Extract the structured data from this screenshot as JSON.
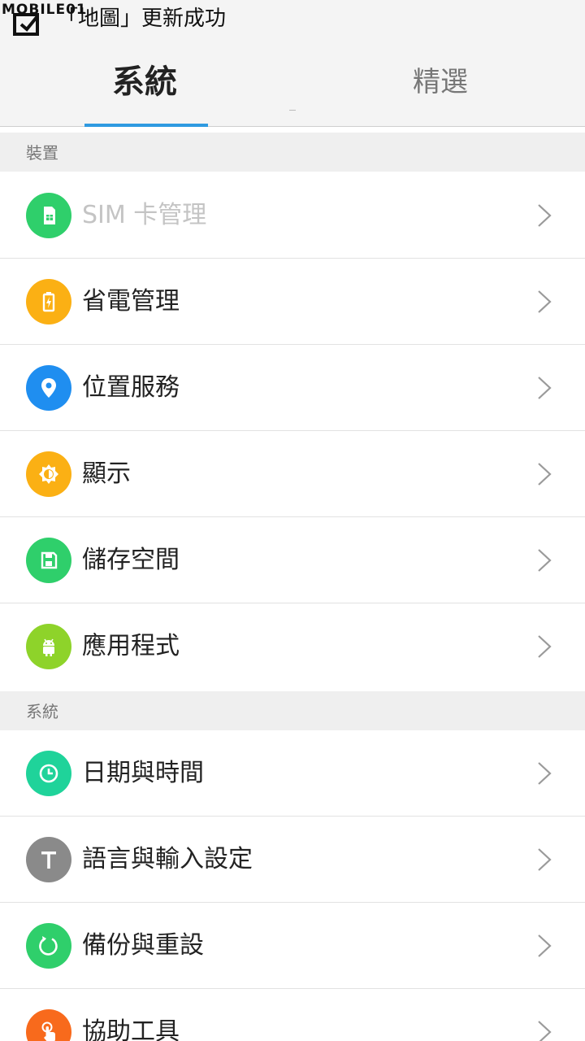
{
  "notification": {
    "watermark": "MOBILE01",
    "text": "「地圖」更新成功"
  },
  "tabs": [
    {
      "label": "系統",
      "active": true
    },
    {
      "label": "精選",
      "active": false
    }
  ],
  "sections": {
    "device": "裝置",
    "system": "系統"
  },
  "items": [
    {
      "label": "SIM 卡管理",
      "icon": "sim-card-icon",
      "color": "#2fcf6b",
      "disabled": true
    },
    {
      "label": "省電管理",
      "icon": "battery-icon",
      "color": "#fbb014",
      "disabled": false
    },
    {
      "label": "位置服務",
      "icon": "location-pin-icon",
      "color": "#1f8ef0",
      "disabled": false
    },
    {
      "label": "顯示",
      "icon": "brightness-icon",
      "color": "#fbb014",
      "disabled": false
    },
    {
      "label": "儲存空間",
      "icon": "storage-icon",
      "color": "#2fcf6b",
      "disabled": false
    },
    {
      "label": "應用程式",
      "icon": "android-icon",
      "color": "#8ed32a",
      "disabled": false
    },
    {
      "label": "日期與時間",
      "icon": "clock-icon",
      "color": "#1fd39a",
      "disabled": false
    },
    {
      "label": "語言與輸入設定",
      "icon": "text-t-icon",
      "color": "#8a8a8a",
      "disabled": false
    },
    {
      "label": "備份與重設",
      "icon": "refresh-icon",
      "color": "#2fcf6b",
      "disabled": false
    },
    {
      "label": "協助工具",
      "icon": "touch-hand-icon",
      "color": "#f86a1c",
      "disabled": false
    }
  ]
}
